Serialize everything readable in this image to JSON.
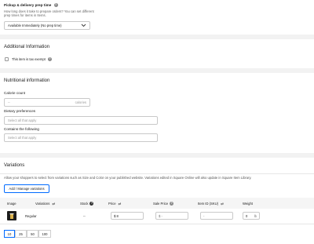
{
  "pickup": {
    "label": "Pickup & delivery prep time",
    "help": "How long does it take to prepare orders? You can set different prep times for items in Items.",
    "select_value": "Available Immediately (No prep time)"
  },
  "additional": {
    "title": "Additional Information",
    "tax_label": "This item is tax exempt"
  },
  "nutrition": {
    "title": "Nutritional information",
    "calorie_label": "Calorie count",
    "calorie_value": "--",
    "calorie_unit": "calories",
    "dietary_label": "Dietary preferences",
    "dietary_placeholder": "Select all that apply",
    "contains_label": "Contains the following",
    "contains_placeholder": "Select all that apply"
  },
  "variations": {
    "title": "Variations",
    "description": "Allow your shoppers to select from variations such as Size and Color on your published website. Variations edited in Square Online will also update in Square Item Library.",
    "manage_button": "Add / Manage variations",
    "columns": [
      "Image",
      "Variations",
      "Stock",
      "Price",
      "Sale Price",
      "Item ID (SKU)",
      "Weight"
    ],
    "row": {
      "name": "Regular",
      "stock": "--",
      "price": "$ 8",
      "sale_price": "$ -",
      "sku": "-",
      "weight": "0",
      "weight_unit": "lb"
    },
    "page_sizes": [
      "10",
      "25",
      "50",
      "100"
    ],
    "selected_page_size": "10"
  },
  "colors": {
    "accent": "#006aff",
    "background": "#f2f2f2",
    "card": "#ffffff",
    "border": "#c9c9c9"
  }
}
